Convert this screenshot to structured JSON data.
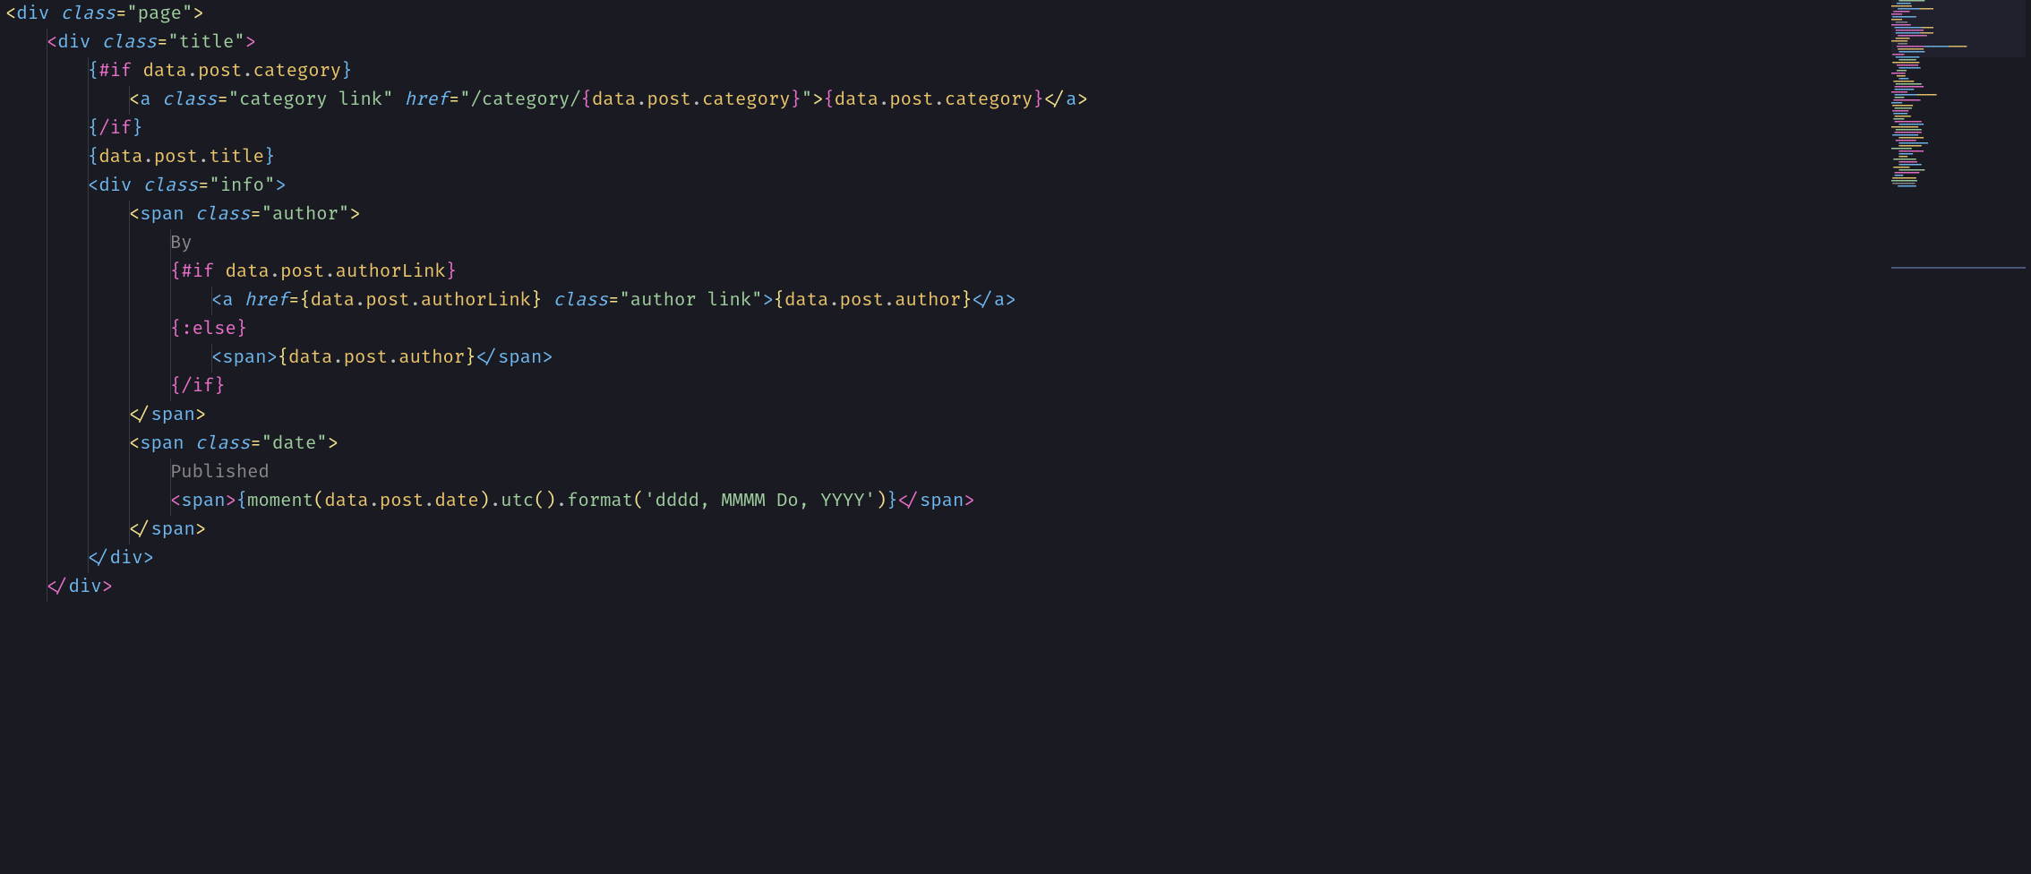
{
  "editor": {
    "lines": [
      {
        "indent": 0,
        "tokens": [
          {
            "t": "punct",
            "v": "<"
          },
          {
            "t": "tag",
            "v": "div"
          },
          {
            "t": "ident",
            "v": " "
          },
          {
            "t": "attr",
            "v": "class"
          },
          {
            "t": "punct",
            "v": "="
          },
          {
            "t": "str",
            "v": "\"page\""
          },
          {
            "t": "punct",
            "v": ">"
          }
        ]
      },
      {
        "indent": 1,
        "tokens": [
          {
            "t": "bracket-m",
            "v": "<"
          },
          {
            "t": "tag",
            "v": "div"
          },
          {
            "t": "ident",
            "v": " "
          },
          {
            "t": "attr",
            "v": "class"
          },
          {
            "t": "punct",
            "v": "="
          },
          {
            "t": "str",
            "v": "\"title\""
          },
          {
            "t": "bracket-m",
            "v": ">"
          }
        ]
      },
      {
        "indent": 2,
        "tokens": [
          {
            "t": "brace-b",
            "v": "{"
          },
          {
            "t": "kw",
            "v": "#if"
          },
          {
            "t": "ident",
            "v": " "
          },
          {
            "t": "var",
            "v": "data"
          },
          {
            "t": "dot",
            "v": "."
          },
          {
            "t": "var",
            "v": "post"
          },
          {
            "t": "dot",
            "v": "."
          },
          {
            "t": "var",
            "v": "category"
          },
          {
            "t": "brace-b",
            "v": "}"
          }
        ]
      },
      {
        "indent": 3,
        "tokens": [
          {
            "t": "brace-y",
            "v": "<"
          },
          {
            "t": "tag",
            "v": "a"
          },
          {
            "t": "ident",
            "v": " "
          },
          {
            "t": "attr",
            "v": "class"
          },
          {
            "t": "punct",
            "v": "="
          },
          {
            "t": "str",
            "v": "\"category link\""
          },
          {
            "t": "ident",
            "v": " "
          },
          {
            "t": "attr",
            "v": "href"
          },
          {
            "t": "punct",
            "v": "="
          },
          {
            "t": "str",
            "v": "\"/category/"
          },
          {
            "t": "brace-m",
            "v": "{"
          },
          {
            "t": "var",
            "v": "data"
          },
          {
            "t": "dot",
            "v": "."
          },
          {
            "t": "var",
            "v": "post"
          },
          {
            "t": "dot",
            "v": "."
          },
          {
            "t": "var",
            "v": "category"
          },
          {
            "t": "brace-m",
            "v": "}"
          },
          {
            "t": "str",
            "v": "\""
          },
          {
            "t": "brace-y",
            "v": ">"
          },
          {
            "t": "brace-m",
            "v": "{"
          },
          {
            "t": "var",
            "v": "data"
          },
          {
            "t": "dot",
            "v": "."
          },
          {
            "t": "var",
            "v": "post"
          },
          {
            "t": "dot",
            "v": "."
          },
          {
            "t": "var",
            "v": "category"
          },
          {
            "t": "brace-m",
            "v": "}"
          },
          {
            "t": "brace-y",
            "v": "</"
          },
          {
            "t": "tag",
            "v": "a"
          },
          {
            "t": "brace-y",
            "v": ">"
          }
        ]
      },
      {
        "indent": 2,
        "tokens": [
          {
            "t": "brace-b",
            "v": "{"
          },
          {
            "t": "kw",
            "v": "/if"
          },
          {
            "t": "brace-b",
            "v": "}"
          }
        ]
      },
      {
        "indent": 2,
        "tokens": [
          {
            "t": "brace-b",
            "v": "{"
          },
          {
            "t": "var",
            "v": "data"
          },
          {
            "t": "dot",
            "v": "."
          },
          {
            "t": "var",
            "v": "post"
          },
          {
            "t": "dot",
            "v": "."
          },
          {
            "t": "var",
            "v": "title"
          },
          {
            "t": "brace-b",
            "v": "}"
          }
        ]
      },
      {
        "indent": 2,
        "tokens": [
          {
            "t": "bracket-b",
            "v": "<"
          },
          {
            "t": "tag",
            "v": "div"
          },
          {
            "t": "ident",
            "v": " "
          },
          {
            "t": "attr",
            "v": "class"
          },
          {
            "t": "punct",
            "v": "="
          },
          {
            "t": "str",
            "v": "\"info\""
          },
          {
            "t": "bracket-b",
            "v": ">"
          }
        ]
      },
      {
        "indent": 3,
        "tokens": [
          {
            "t": "brace-y",
            "v": "<"
          },
          {
            "t": "tag",
            "v": "span"
          },
          {
            "t": "ident",
            "v": " "
          },
          {
            "t": "attr",
            "v": "class"
          },
          {
            "t": "punct",
            "v": "="
          },
          {
            "t": "str",
            "v": "\"author\""
          },
          {
            "t": "brace-y",
            "v": ">"
          }
        ]
      },
      {
        "indent": 4,
        "tokens": [
          {
            "t": "txt",
            "v": "By"
          }
        ]
      },
      {
        "indent": 4,
        "tokens": [
          {
            "t": "brace-m",
            "v": "{"
          },
          {
            "t": "kw",
            "v": "#if"
          },
          {
            "t": "ident",
            "v": " "
          },
          {
            "t": "var",
            "v": "data"
          },
          {
            "t": "dot",
            "v": "."
          },
          {
            "t": "var",
            "v": "post"
          },
          {
            "t": "dot",
            "v": "."
          },
          {
            "t": "var",
            "v": "authorLink"
          },
          {
            "t": "brace-m",
            "v": "}"
          }
        ]
      },
      {
        "indent": 5,
        "tokens": [
          {
            "t": "bracket-b",
            "v": "<"
          },
          {
            "t": "tag",
            "v": "a"
          },
          {
            "t": "ident",
            "v": " "
          },
          {
            "t": "attr",
            "v": "href"
          },
          {
            "t": "punct",
            "v": "="
          },
          {
            "t": "brace-y",
            "v": "{"
          },
          {
            "t": "var",
            "v": "data"
          },
          {
            "t": "dot",
            "v": "."
          },
          {
            "t": "var",
            "v": "post"
          },
          {
            "t": "dot",
            "v": "."
          },
          {
            "t": "var",
            "v": "authorLink"
          },
          {
            "t": "brace-y",
            "v": "}"
          },
          {
            "t": "ident",
            "v": " "
          },
          {
            "t": "attr",
            "v": "class"
          },
          {
            "t": "punct",
            "v": "="
          },
          {
            "t": "str",
            "v": "\"author link\""
          },
          {
            "t": "bracket-b",
            "v": ">"
          },
          {
            "t": "brace-y",
            "v": "{"
          },
          {
            "t": "var",
            "v": "data"
          },
          {
            "t": "dot",
            "v": "."
          },
          {
            "t": "var",
            "v": "post"
          },
          {
            "t": "dot",
            "v": "."
          },
          {
            "t": "var",
            "v": "author"
          },
          {
            "t": "brace-y",
            "v": "}"
          },
          {
            "t": "bracket-b",
            "v": "</"
          },
          {
            "t": "tag",
            "v": "a"
          },
          {
            "t": "bracket-b",
            "v": ">"
          }
        ]
      },
      {
        "indent": 4,
        "tokens": [
          {
            "t": "brace-m",
            "v": "{"
          },
          {
            "t": "kw",
            "v": ":else"
          },
          {
            "t": "brace-m",
            "v": "}"
          }
        ]
      },
      {
        "indent": 5,
        "tokens": [
          {
            "t": "bracket-b",
            "v": "<"
          },
          {
            "t": "tag",
            "v": "span"
          },
          {
            "t": "bracket-b",
            "v": ">"
          },
          {
            "t": "brace-y",
            "v": "{"
          },
          {
            "t": "var",
            "v": "data"
          },
          {
            "t": "dot",
            "v": "."
          },
          {
            "t": "var",
            "v": "post"
          },
          {
            "t": "dot",
            "v": "."
          },
          {
            "t": "var",
            "v": "author"
          },
          {
            "t": "brace-y",
            "v": "}"
          },
          {
            "t": "bracket-b",
            "v": "</"
          },
          {
            "t": "tag",
            "v": "span"
          },
          {
            "t": "bracket-b",
            "v": ">"
          }
        ]
      },
      {
        "indent": 4,
        "tokens": [
          {
            "t": "brace-m",
            "v": "{"
          },
          {
            "t": "kw",
            "v": "/if"
          },
          {
            "t": "brace-m",
            "v": "}"
          }
        ]
      },
      {
        "indent": 3,
        "tokens": [
          {
            "t": "brace-y",
            "v": "</"
          },
          {
            "t": "tag",
            "v": "span"
          },
          {
            "t": "brace-y",
            "v": ">"
          }
        ]
      },
      {
        "indent": 3,
        "tokens": [
          {
            "t": "brace-y",
            "v": "<"
          },
          {
            "t": "tag",
            "v": "span"
          },
          {
            "t": "ident",
            "v": " "
          },
          {
            "t": "attr",
            "v": "class"
          },
          {
            "t": "punct",
            "v": "="
          },
          {
            "t": "str",
            "v": "\"date\""
          },
          {
            "t": "brace-y",
            "v": ">"
          }
        ]
      },
      {
        "indent": 4,
        "tokens": [
          {
            "t": "txt",
            "v": "Published"
          }
        ]
      },
      {
        "indent": 4,
        "tokens": [
          {
            "t": "bracket-m",
            "v": "<"
          },
          {
            "t": "tag",
            "v": "span"
          },
          {
            "t": "bracket-m",
            "v": ">"
          },
          {
            "t": "brace-b",
            "v": "{"
          },
          {
            "t": "fn",
            "v": "moment"
          },
          {
            "t": "paren",
            "v": "("
          },
          {
            "t": "var",
            "v": "data"
          },
          {
            "t": "dot",
            "v": "."
          },
          {
            "t": "var",
            "v": "post"
          },
          {
            "t": "dot",
            "v": "."
          },
          {
            "t": "var",
            "v": "date"
          },
          {
            "t": "paren",
            "v": ")"
          },
          {
            "t": "dot",
            "v": "."
          },
          {
            "t": "fn",
            "v": "utc"
          },
          {
            "t": "paren",
            "v": "()"
          },
          {
            "t": "dot",
            "v": "."
          },
          {
            "t": "fn",
            "v": "format"
          },
          {
            "t": "paren",
            "v": "("
          },
          {
            "t": "str",
            "v": "'dddd, MMMM Do, YYYY'"
          },
          {
            "t": "paren",
            "v": ")"
          },
          {
            "t": "brace-b",
            "v": "}"
          },
          {
            "t": "bracket-m",
            "v": "</"
          },
          {
            "t": "tag",
            "v": "span"
          },
          {
            "t": "bracket-m",
            "v": ">"
          }
        ]
      },
      {
        "indent": 3,
        "tokens": [
          {
            "t": "brace-y",
            "v": "</"
          },
          {
            "t": "tag",
            "v": "span"
          },
          {
            "t": "brace-y",
            "v": ">"
          }
        ]
      },
      {
        "indent": 2,
        "tokens": [
          {
            "t": "bracket-b",
            "v": "</"
          },
          {
            "t": "tag",
            "v": "div"
          },
          {
            "t": "bracket-b",
            "v": ">"
          }
        ]
      },
      {
        "indent": 1,
        "tokens": [
          {
            "t": "bracket-m",
            "v": "</"
          },
          {
            "t": "tag",
            "v": "div"
          },
          {
            "t": "bracket-m",
            "v": ">"
          }
        ]
      }
    ]
  },
  "minimap": {
    "lines": [
      "g",
      "b",
      "y",
      "by",
      "m",
      "m",
      "b",
      "y",
      "w",
      "m",
      "by",
      "m",
      "by",
      "m",
      "y",
      "y",
      "w",
      "mby",
      "y",
      "b",
      "m",
      "b",
      "g",
      "y",
      "m",
      "b",
      "g",
      "m",
      "y",
      "b",
      "y",
      "g",
      "m",
      "b",
      "m",
      "by",
      "g",
      "m",
      "b",
      "y",
      "g",
      "m",
      "b",
      "y",
      "g",
      "m",
      "b",
      "y",
      "g",
      "m",
      "b",
      "y",
      "m",
      "b",
      "y",
      "g",
      "m",
      "b",
      "y",
      "g",
      "m",
      "b",
      "y",
      "g",
      "m",
      "b",
      "y",
      "g",
      "w",
      "b"
    ]
  }
}
